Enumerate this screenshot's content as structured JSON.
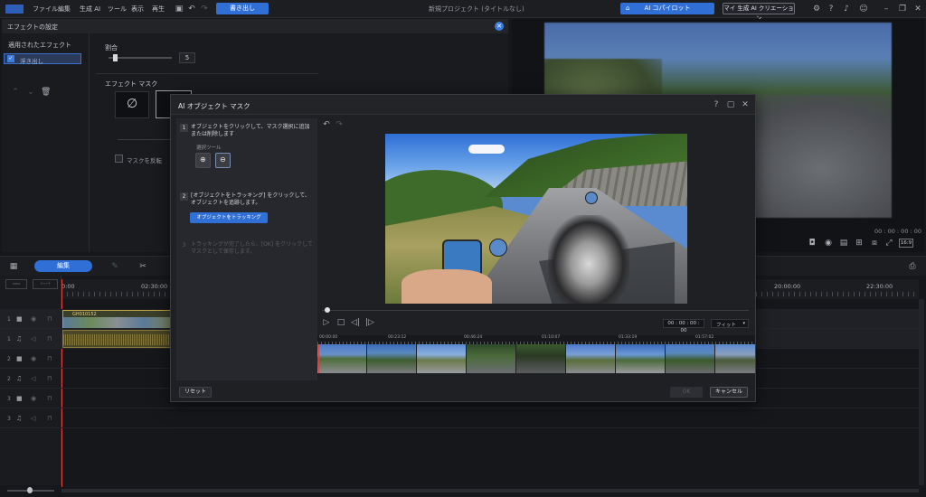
{
  "menubar": {
    "logo": "PowerDirector",
    "items": [
      "ファイル",
      "編集",
      "生成 AI",
      "ツール",
      "表示",
      "再生"
    ],
    "export_label": "書き出し",
    "project_title": "新規プロジェクト (タイトルなし)",
    "ai_copilot_label": "AI コパイロット",
    "my_ai_label": "マイ 生成 AI クリエーション"
  },
  "effect_settings": {
    "title": "エフェクトの設定",
    "applied_effects_label": "適用されたエフェクト",
    "effect_item": "浮き出し",
    "ratio_label": "割合",
    "ratio_value": "5",
    "effect_mask_label": "エフェクト マスク",
    "invert_mask_label": "マスクを反転"
  },
  "preview": {
    "timecode": "00 : 00 : 00 : 00",
    "aspect": "16:9"
  },
  "timeline": {
    "edit_tab": "編集",
    "ruler": [
      "0:00",
      "02:30:00",
      "20:00:00",
      "22:30:00"
    ],
    "clip_name": "GH010152",
    "tracks": [
      "1",
      "1",
      "2",
      "2",
      "3",
      "3"
    ]
  },
  "modal": {
    "title": "AI オブジェクト マスク",
    "step1_num": "1",
    "step1_text": "オブジェクトをクリックして、マスク選択に追加または削除します",
    "select_tool_label": "選択ツール",
    "step2_num": "2",
    "step2_text": "[オブジェクトをトラッキング] をクリックして、オブジェクトを追跡します。",
    "track_button": "オブジェクトをトラッキング",
    "step3_num": "3",
    "step3_text": "トラッキングが完了したら、[OK] をクリックしてマスクとして保存します。",
    "timecode": "00 : 00 : 00 : 00",
    "fit_option": "フィット",
    "strip_times": [
      "00:00:00",
      "00:23:12",
      "00:46:24",
      "01:10:07",
      "01:33:19",
      "01:57:02"
    ],
    "reset_button": "リセット",
    "ok_button": "OK",
    "cancel_button": "キャンセル"
  }
}
